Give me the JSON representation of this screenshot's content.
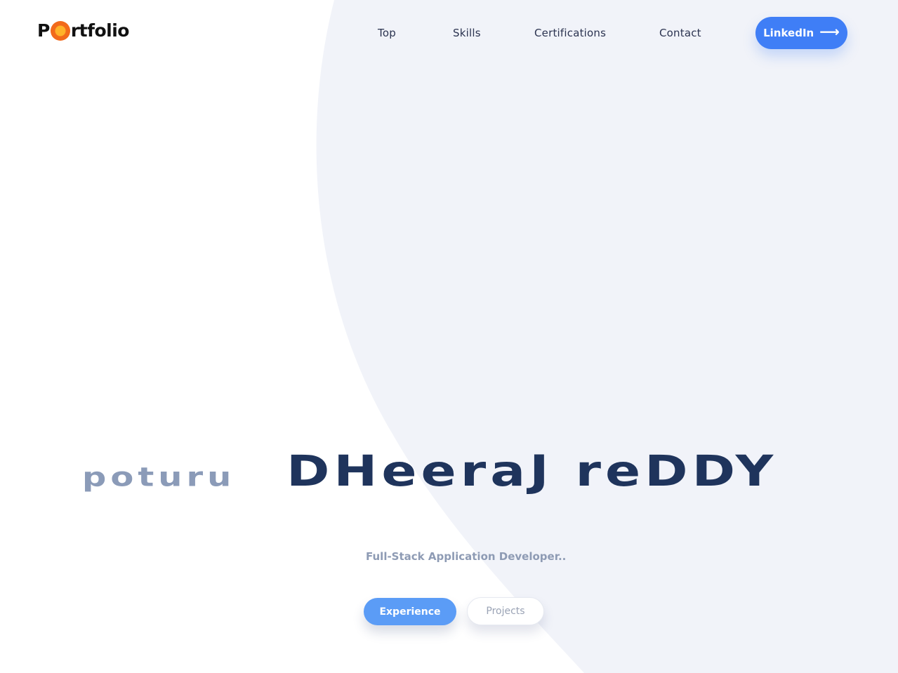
{
  "header": {
    "logo": {
      "prefix": "P",
      "suffix": "rtfolio",
      "dot_colors": [
        "#f26a1b",
        "#ffb22a"
      ]
    },
    "nav": [
      {
        "label": "Top"
      },
      {
        "label": "Skills"
      },
      {
        "label": "Certifications"
      },
      {
        "label": "Contact"
      }
    ],
    "linkedin_button": {
      "label": "LinkedIn",
      "icon": "arrow-right-icon"
    }
  },
  "hero": {
    "first_name": "poturu",
    "last_names": "DHeeraJ reDDY",
    "subtitle": "Full-Stack Application Developer..",
    "primary_button": "Experience",
    "secondary_button": "Projects"
  },
  "colors": {
    "accent": "#3f7ef6",
    "primary_button": "#5b9cf6",
    "name_dark": "#1f345c",
    "name_light": "#8b9bb8",
    "background_shape": "#f1f3f9"
  }
}
